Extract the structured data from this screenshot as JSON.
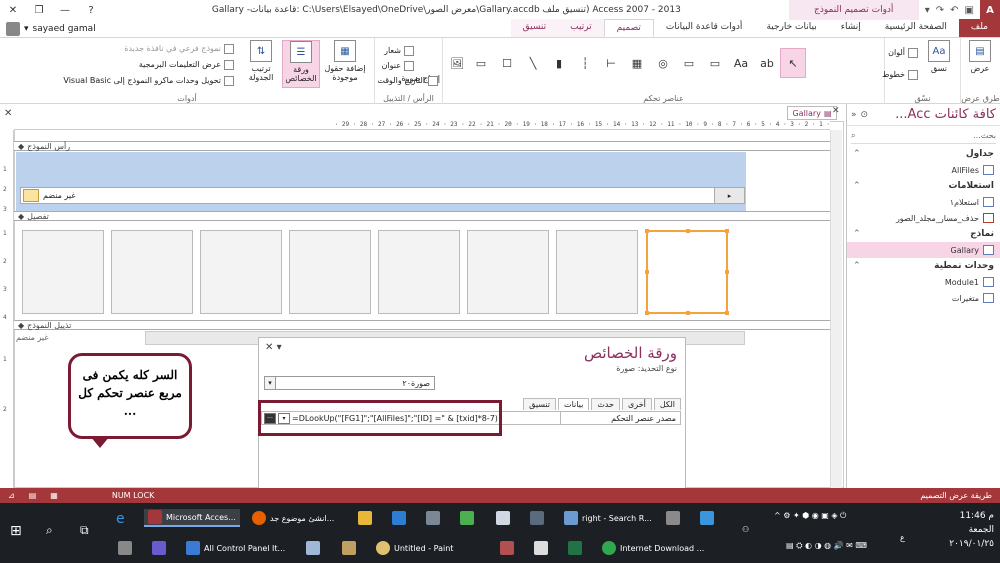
{
  "titlebar": {
    "title": "Access 2007 - 2013 (تنسيق ملف Gallary.accdb\\معرض الصور\\C:\\Users\\Elsayed\\OneDrive :قاعدة بيانات- Gallary",
    "contextual_group": "أدوات تصميم النموذج",
    "app_icon": "A",
    "help": "?"
  },
  "user": {
    "name": "sayaed gamal"
  },
  "tabs": [
    {
      "label": "ملف"
    },
    {
      "label": "الصفحة الرئيسية"
    },
    {
      "label": "إنشاء"
    },
    {
      "label": "بيانات خارجية"
    },
    {
      "label": "أدوات قاعدة البيانات"
    },
    {
      "label": "تصميم"
    },
    {
      "label": "ترتيب"
    },
    {
      "label": "تنسيق"
    }
  ],
  "ribbon": {
    "views": {
      "label": "عرض",
      "group": "طرق عرض"
    },
    "themes": {
      "theme": "نسق",
      "colors": "ألوان",
      "fonts": "خطوط",
      "group": "نسّق"
    },
    "controls_group": "عناصر تحكم",
    "insert_image": "إدراج صورة",
    "header_footer": {
      "logo": "شعار",
      "title": "عنوان",
      "datetime": "التاريخ والوقت",
      "group": "الرأس / التذييل"
    },
    "tools": {
      "add_fields": "إضافة حقول موجودة",
      "property_sheet": "ورقة الخصائص",
      "tab_order": "ترتيب الجدولة",
      "subform": "نموذج فرعي في نافذة جديدة",
      "view_code": "عرض التعليمات البرمجية",
      "convert_macros": "تحويل وحدات ماكرو النموذج إلى Visual Basic",
      "group": "أدوات"
    }
  },
  "nav": {
    "title": "كافة كائنات Acc...",
    "search_placeholder": "بحث...",
    "categories": [
      {
        "label": "جداول",
        "items": [
          {
            "label": "AllFiles"
          }
        ]
      },
      {
        "label": "استعلامات",
        "items": [
          {
            "label": "استعلام١"
          },
          {
            "label": "حذف_مسار_مجلد_الصور"
          }
        ]
      },
      {
        "label": "نماذج",
        "items": [
          {
            "label": "Gallary"
          }
        ]
      },
      {
        "label": "وحدات نمطية",
        "items": [
          {
            "label": "Module1"
          },
          {
            "label": "متغيرات"
          }
        ]
      }
    ]
  },
  "document": {
    "tab_label": "Gallary",
    "ruler_text": "· 1 · 2 · 3 · 4 · 5 · 6 · 7 · 8 · 9 · 10 · 11 · 12 · 13 · 14 · 15 · 16 · 17 · 18 · 19 · 20 · 21 · 22 · 23 · 24 · 25 · 26 · 27 · 28 · 29 ·",
    "form_header": "رأس النموذج",
    "detail": "تفصيل",
    "form_footer": "تذييل النموذج",
    "unbound_header": "غير منضم",
    "unbound_footer": "غير منضم",
    "vruler": [
      "1",
      "2",
      "3",
      "1",
      "2",
      "3",
      "4",
      "1",
      "2"
    ]
  },
  "callout": {
    "text": "السر كله يكمن فى مربع عنصر تحكم كل ..."
  },
  "property_sheet": {
    "title": "ورقة الخصائص",
    "selection_type_label": "نوع التحديد:  صورة",
    "selected_control": "صورة٢٠",
    "tabs": [
      "الكل",
      "أخرى",
      "حدث",
      "بيانات",
      "تنسيق"
    ],
    "row_label": "مصدر عنصر التحكم",
    "row_value": "=DLookUp(\"[FG1]\";\"[AllFiles]\";\"[ID] =\" & [txid]*8-7)"
  },
  "statusbar": {
    "left": "NUM LOCK",
    "right": "طريقة عرض التصميم"
  },
  "taskbar": {
    "items": [
      {
        "label": "Microsoft Acces..."
      },
      {
        "label": "انشىٔ موضوع جد..."
      },
      {
        "label": "right - Search R..."
      },
      {
        "label": "All Control Panel It..."
      },
      {
        "label": "Untitled - Paint"
      },
      {
        "label": "Internet Download ..."
      }
    ],
    "time": "11:46 م",
    "day": "الجمعة",
    "date": "٢٠١٩/٠١/٢٥",
    "lang": "ع"
  }
}
